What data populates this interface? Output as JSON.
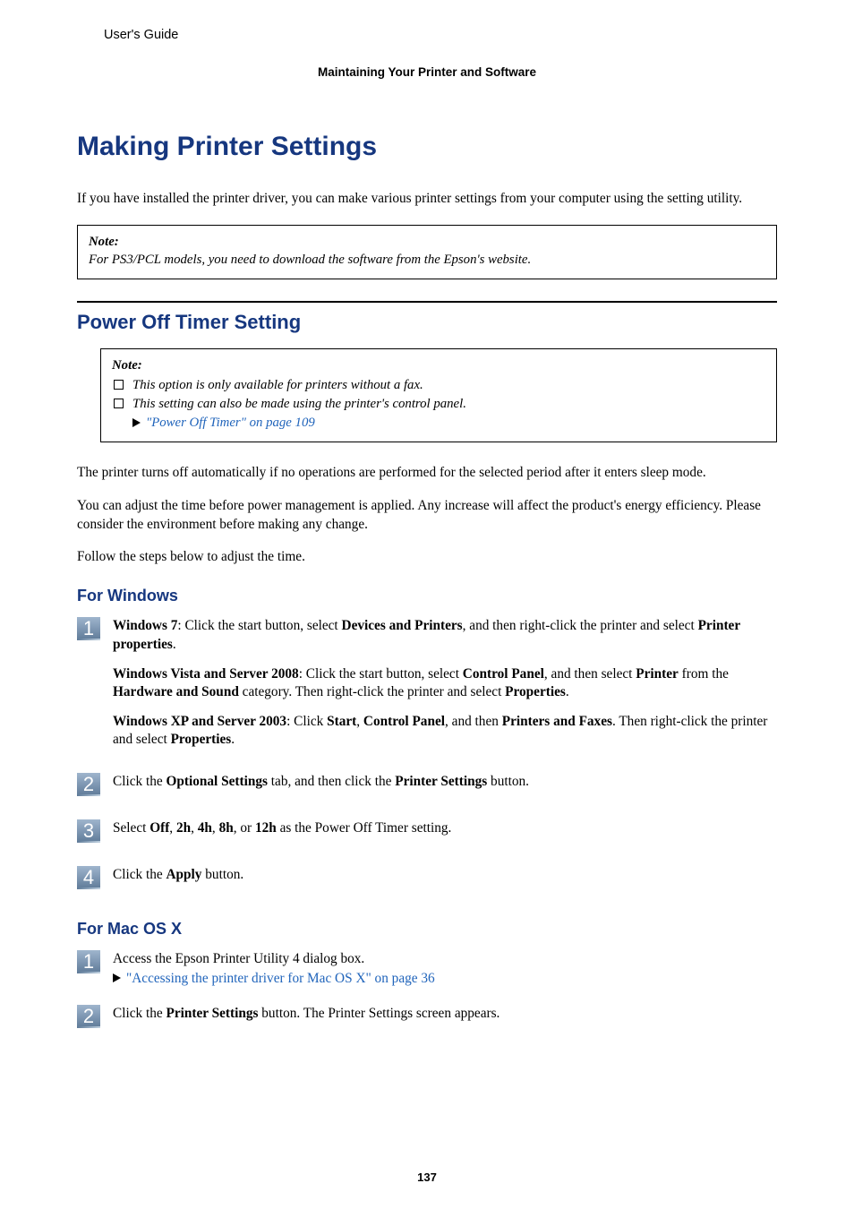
{
  "running_head": "User's Guide",
  "section_label": "Maintaining Your Printer and Software",
  "h1": "Making Printer Settings",
  "intro": "If you have installed the printer driver, you can make various printer settings from your computer using the setting utility.",
  "note1_head": "Note:",
  "note1_body": "For PS3/PCL models, you need to download the software from the Epson's website.",
  "h2": "Power Off Timer Setting",
  "note2_head": "Note:",
  "note2_li1": "This option is only available for printers without a fax.",
  "note2_li2": "This setting can also be made using the printer's control panel.",
  "note2_ref": "\"Power Off Timer\" on page 109",
  "body_p1": "The printer turns off automatically if no operations are performed for the selected period after it enters sleep mode.",
  "body_p2": "You can adjust the time before power management is applied. Any increase will affect the product's energy efficiency. Please consider the environment before making any change.",
  "body_p3": "Follow the steps below to adjust the time.",
  "h3_win": "For Windows",
  "win_s1_b1": "Windows 7",
  "win_s1_t1": ": Click the start button, select ",
  "win_s1_b2": "Devices and Printers",
  "win_s1_t2": ", and then right-click the printer and select ",
  "win_s1_b3": "Printer properties",
  "win_s1_t3": ".",
  "win_s1p2_b1": "Windows Vista and Server 2008",
  "win_s1p2_t1": ": Click the start button, select ",
  "win_s1p2_b2": "Control Panel",
  "win_s1p2_t2": ", and then select ",
  "win_s1p2_b3": "Printer",
  "win_s1p2_t3": " from the ",
  "win_s1p2_b4": "Hardware and Sound",
  "win_s1p2_t4": " category. Then right-click the printer and select ",
  "win_s1p2_b5": "Properties",
  "win_s1p2_t5": ".",
  "win_s1p3_b1": "Windows XP and Server 2003",
  "win_s1p3_t1": ": Click ",
  "win_s1p3_b2": "Start",
  "win_s1p3_t2": ", ",
  "win_s1p3_b3": "Control Panel",
  "win_s1p3_t3": ", and then ",
  "win_s1p3_b4": "Printers and Faxes",
  "win_s1p3_t4": ". Then right-click the printer and select ",
  "win_s1p3_b5": "Properties",
  "win_s1p3_t5": ".",
  "win_s2_t1": "Click the ",
  "win_s2_b1": "Optional Settings",
  "win_s2_t2": " tab, and then click the ",
  "win_s2_b2": "Printer Settings",
  "win_s2_t3": " button.",
  "win_s3_t1": "Select ",
  "win_s3_b1": "Off",
  "win_s3_t2": ", ",
  "win_s3_b2": "2h",
  "win_s3_t3": ", ",
  "win_s3_b3": "4h",
  "win_s3_t4": ", ",
  "win_s3_b4": "8h",
  "win_s3_t5": ", or ",
  "win_s3_b5": "12h",
  "win_s3_t6": " as the Power Off Timer setting.",
  "win_s4_t1": "Click the ",
  "win_s4_b1": "Apply",
  "win_s4_t2": " button.",
  "h3_mac": "For Mac OS X",
  "mac_s1_t1": "Access the Epson Printer Utility 4 dialog box.",
  "mac_s1_ref": "\"Accessing the printer driver for Mac OS X\" on page 36",
  "mac_s2_t1": "Click the ",
  "mac_s2_b1": "Printer Settings",
  "mac_s2_t2": " button. The Printer Settings screen appears.",
  "step_numbers": {
    "one": "1",
    "two": "2",
    "three": "3",
    "four": "4"
  },
  "page_number": "137"
}
